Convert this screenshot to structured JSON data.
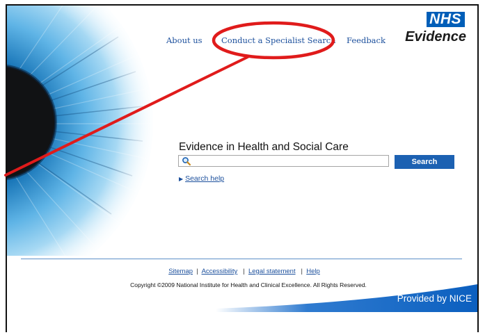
{
  "nav": {
    "about": "About us",
    "specialist_search": "Conduct a Specialist Search",
    "feedback": "Feedback"
  },
  "brand": {
    "logo": "NHS",
    "name": "Evidence"
  },
  "main": {
    "heading": "Evidence in Health and Social Care",
    "search_value": "",
    "search_button": "Search",
    "help_link": "Search help"
  },
  "footer": {
    "sitemap": "Sitemap",
    "accessibility": "Accessibility",
    "legal": "Legal statement",
    "help": "Help",
    "copyright": "Copyright ©2009 National Institute for Health and Clinical Excellence. All Rights Reserved.",
    "provided_by": "Provided by NICE"
  },
  "colors": {
    "nhs_blue": "#005eb8",
    "link_blue": "#1b4f9c",
    "button_blue": "#1c61b2",
    "annotation_red": "#e01b1b"
  }
}
